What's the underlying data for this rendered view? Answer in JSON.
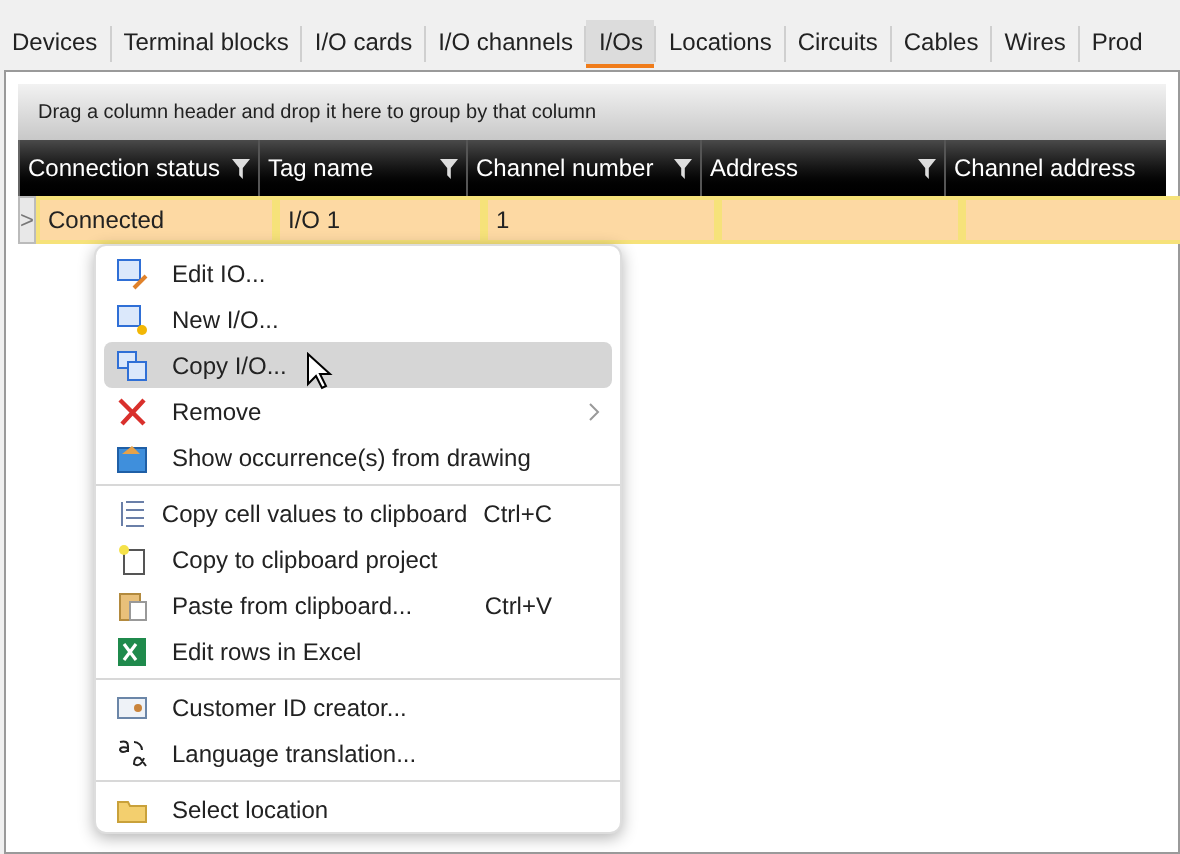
{
  "tabs": [
    {
      "label": "Devices",
      "selected": false
    },
    {
      "label": "Terminal blocks",
      "selected": false
    },
    {
      "label": "I/O cards",
      "selected": false
    },
    {
      "label": "I/O channels",
      "selected": false
    },
    {
      "label": "I/Os",
      "selected": true
    },
    {
      "label": "Locations",
      "selected": false
    },
    {
      "label": "Circuits",
      "selected": false
    },
    {
      "label": "Cables",
      "selected": false
    },
    {
      "label": "Wires",
      "selected": false
    },
    {
      "label": "Prod",
      "selected": false
    }
  ],
  "group_panel": {
    "hint": "Drag a column header and drop it here to group by that column"
  },
  "table": {
    "columns": [
      "Connection status",
      "Tag name",
      "Channel number",
      "Address",
      "Channel address"
    ],
    "rows": [
      {
        "expander": ">",
        "selected": true,
        "cells": [
          "Connected",
          "I/O 1",
          "1",
          "",
          ""
        ]
      }
    ]
  },
  "context_menu": {
    "items": [
      {
        "kind": "item",
        "label": "Edit IO...",
        "selected": false
      },
      {
        "kind": "item",
        "label": "New I/O...",
        "selected": false
      },
      {
        "kind": "item",
        "label": "Copy I/O...",
        "selected": true
      },
      {
        "kind": "submenu",
        "label": "Remove",
        "selected": false
      },
      {
        "kind": "item",
        "label": "Show occurrence(s) from drawing",
        "selected": false
      },
      {
        "kind": "separator"
      },
      {
        "kind": "item",
        "label": "Copy cell values to clipboard",
        "shortcut": "Ctrl+C",
        "selected": false
      },
      {
        "kind": "item",
        "label": "Copy to clipboard project",
        "selected": false
      },
      {
        "kind": "item",
        "label": "Paste from clipboard...",
        "shortcut": "Ctrl+V",
        "selected": false
      },
      {
        "kind": "item",
        "label": "Edit rows in Excel",
        "selected": false
      },
      {
        "kind": "separator"
      },
      {
        "kind": "item",
        "label": "Customer ID creator...",
        "selected": false
      },
      {
        "kind": "item",
        "label": "Language translation...",
        "selected": false
      },
      {
        "kind": "separator"
      },
      {
        "kind": "item",
        "label": "Select location",
        "selected": false
      }
    ]
  }
}
